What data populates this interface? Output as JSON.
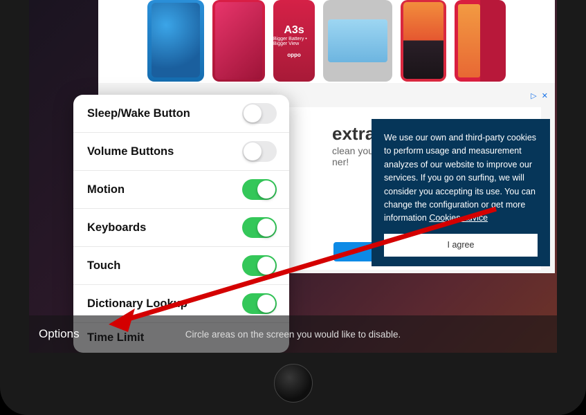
{
  "ad": {
    "indicator_triangle": "▷",
    "indicator_close": "✕"
  },
  "extra": {
    "title": "extra",
    "subtitle": "clean your\nner!"
  },
  "cookie": {
    "text": "We use our own and third-party cookies to perform usage and measurement analyzes of our website to improve our services. If you go on surfing, we will consider you accepting its use. You can change the configuration or get more information ",
    "link": "Cookies advice",
    "agree": "I agree"
  },
  "phone3": {
    "badge": "A3s",
    "sub": "Bigger Battery • Bigger View",
    "brand": "oppo"
  },
  "options": {
    "items": [
      {
        "label": "Sleep/Wake Button",
        "on": false
      },
      {
        "label": "Volume Buttons",
        "on": false
      },
      {
        "label": "Motion",
        "on": true
      },
      {
        "label": "Keyboards",
        "on": true
      },
      {
        "label": "Touch",
        "on": true
      },
      {
        "label": "Dictionary Lookup",
        "on": true
      },
      {
        "label": "Time Limit",
        "on": null
      }
    ]
  },
  "bottom": {
    "options_button": "Options",
    "hint": "Circle areas on the screen you would like to disable."
  }
}
